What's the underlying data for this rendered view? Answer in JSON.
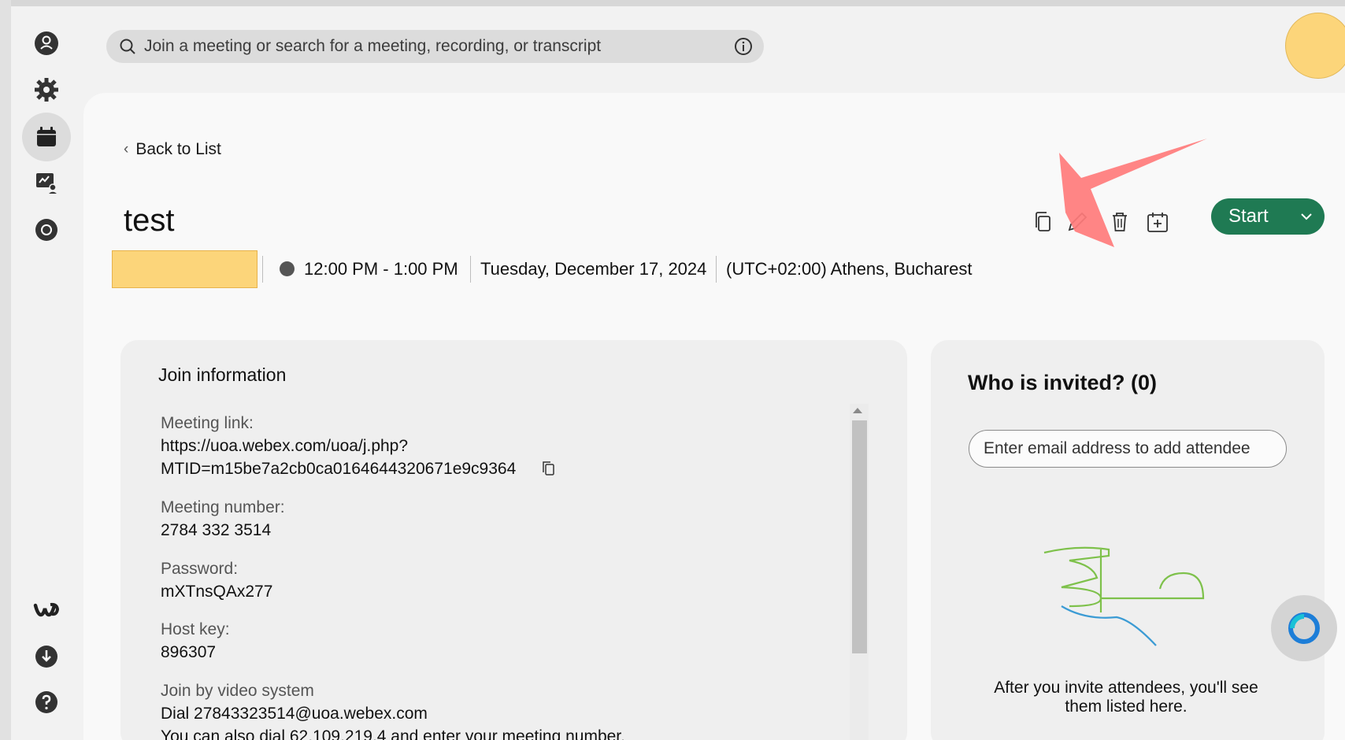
{
  "search": {
    "placeholder": "Join a meeting or search for a meeting, recording, or transcript"
  },
  "rail": {
    "items": [
      "person-icon",
      "gear-icon",
      "calendar-icon",
      "whiteboard-icon",
      "record-icon"
    ],
    "bottom": [
      "webex-logo-icon",
      "download-icon",
      "help-icon"
    ]
  },
  "meeting": {
    "back_label": "Back to List",
    "title": "test",
    "time": "12:00 PM - 1:00 PM",
    "date": "Tuesday, December 17, 2024",
    "timezone": "(UTC+02:00) Athens, Bucharest",
    "start_label": "Start"
  },
  "join": {
    "title": "Join information",
    "link_label": "Meeting link:",
    "link_line1": "https://uoa.webex.com/uoa/j.php?",
    "link_line2": "MTID=m15be7a2cb0ca0164644320671e9c9364",
    "number_label": "Meeting number:",
    "number_value": "2784 332 3514",
    "password_label": "Password:",
    "password_value": "mXTnsQAx277",
    "hostkey_label": "Host key:",
    "hostkey_value": "896307",
    "video_label": "Join by video system",
    "video_value": "Dial 27843323514@uoa.webex.com",
    "video_extra": "You can also dial 62.109.219.4 and enter your meeting number."
  },
  "invite": {
    "title": "Who is invited? (0)",
    "placeholder": "Enter email address to add attendee",
    "note": "After you invite attendees, you'll see them listed here."
  },
  "colors": {
    "brand_green": "#1f7a53",
    "status_yellow": "#fcd57a",
    "annotation_red": "#ff7b7b"
  }
}
